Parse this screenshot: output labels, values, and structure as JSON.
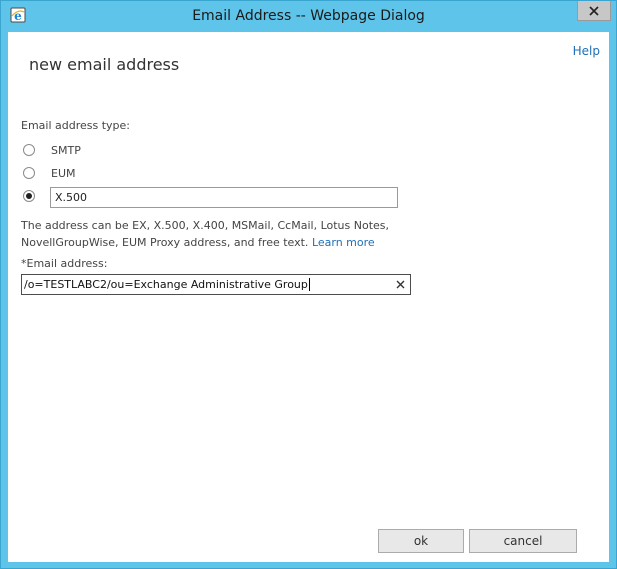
{
  "window": {
    "title": "Email Address -- Webpage Dialog"
  },
  "dialog": {
    "help_label": "Help",
    "page_title": "new email address",
    "address_type_label": "Email address type:",
    "address_types": [
      {
        "label": "SMTP",
        "selected": false
      },
      {
        "label": "EUM",
        "selected": false
      },
      {
        "label": "",
        "selected": true
      }
    ],
    "custom_type_value": "X.500",
    "info_text": "The address can be EX, X.500, X.400, MSMail, CcMail, Lotus Notes, NovellGroupWise, EUM Proxy address, and free text.",
    "learn_more_label": "Learn more",
    "email_label": "*Email address:",
    "email_value": "/o=TESTLABC2/ou=Exchange Administrative Group"
  },
  "buttons": {
    "ok_label": "ok",
    "cancel_label": "cancel"
  },
  "colors": {
    "window_frame": "#5fc4ea",
    "link": "#1f6fb5"
  },
  "icons": {
    "app": "internet-explorer-icon",
    "close": "close-icon",
    "clear": "clear-icon"
  }
}
